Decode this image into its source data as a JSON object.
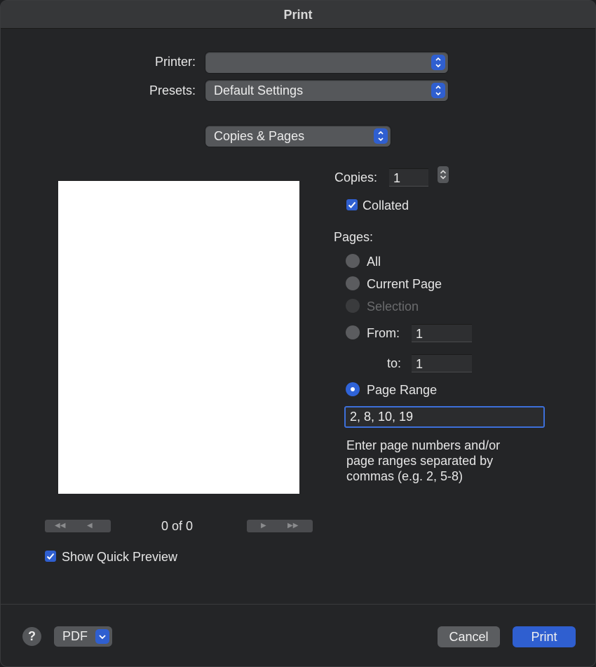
{
  "window": {
    "title": "Print"
  },
  "printer": {
    "label": "Printer:",
    "value": ""
  },
  "presets": {
    "label": "Presets:",
    "value": "Default Settings"
  },
  "section": {
    "value": "Copies & Pages"
  },
  "copies": {
    "label": "Copies:",
    "value": "1"
  },
  "collated": {
    "label": "Collated",
    "checked": true
  },
  "pages": {
    "label": "Pages:",
    "options": {
      "all": "All",
      "current": "Current Page",
      "selection": "Selection",
      "from": "From:",
      "to": "to:",
      "range": "Page Range"
    },
    "from_value": "1",
    "to_value": "1",
    "range_value": "2, 8, 10, 19",
    "hint_lines": [
      "Enter page numbers and/or",
      "page ranges separated by",
      "commas (e.g. 2, 5-8)"
    ]
  },
  "preview": {
    "page_count": "0 of 0",
    "show_quick_preview": "Show Quick Preview",
    "first_glyph": "◀◀",
    "prev_glyph": "◀",
    "next_glyph": "▶",
    "last_glyph": "▶▶"
  },
  "footer": {
    "help": "?",
    "pdf": "PDF",
    "cancel": "Cancel",
    "print": "Print"
  },
  "colors": {
    "accent": "#2f5fd0",
    "background": "#242527",
    "control": "#55575a"
  }
}
